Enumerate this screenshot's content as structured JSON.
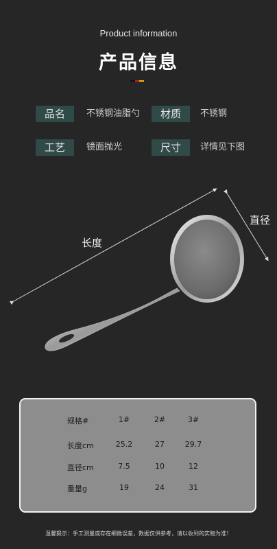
{
  "header": {
    "subtitle": "Product information",
    "title": "产品信息",
    "flag_colors": [
      "#111111",
      "#d61a1a",
      "#f2c200"
    ]
  },
  "info": {
    "name_label": "品名",
    "name_value": "不锈钢油脂勺",
    "material_label": "材质",
    "material_value": "不锈钢",
    "process_label": "工艺",
    "process_value": "镜面抛光",
    "size_label": "尺寸",
    "size_value": "详情见下图"
  },
  "diagram": {
    "length_label": "长度",
    "diameter_label": "直径"
  },
  "spec_table": {
    "header": [
      "规格#",
      "1#",
      "2#",
      "3#"
    ],
    "rows": [
      [
        "长度cm",
        "25.2",
        "27",
        "29.7"
      ],
      [
        "直径cm",
        "7.5",
        "10",
        "12"
      ],
      [
        "重量g",
        "19",
        "24",
        "31"
      ]
    ]
  },
  "footer_note": "温馨提示：手工测量或存在细微误差，数据仅供参考，请以收到的实物为准！"
}
